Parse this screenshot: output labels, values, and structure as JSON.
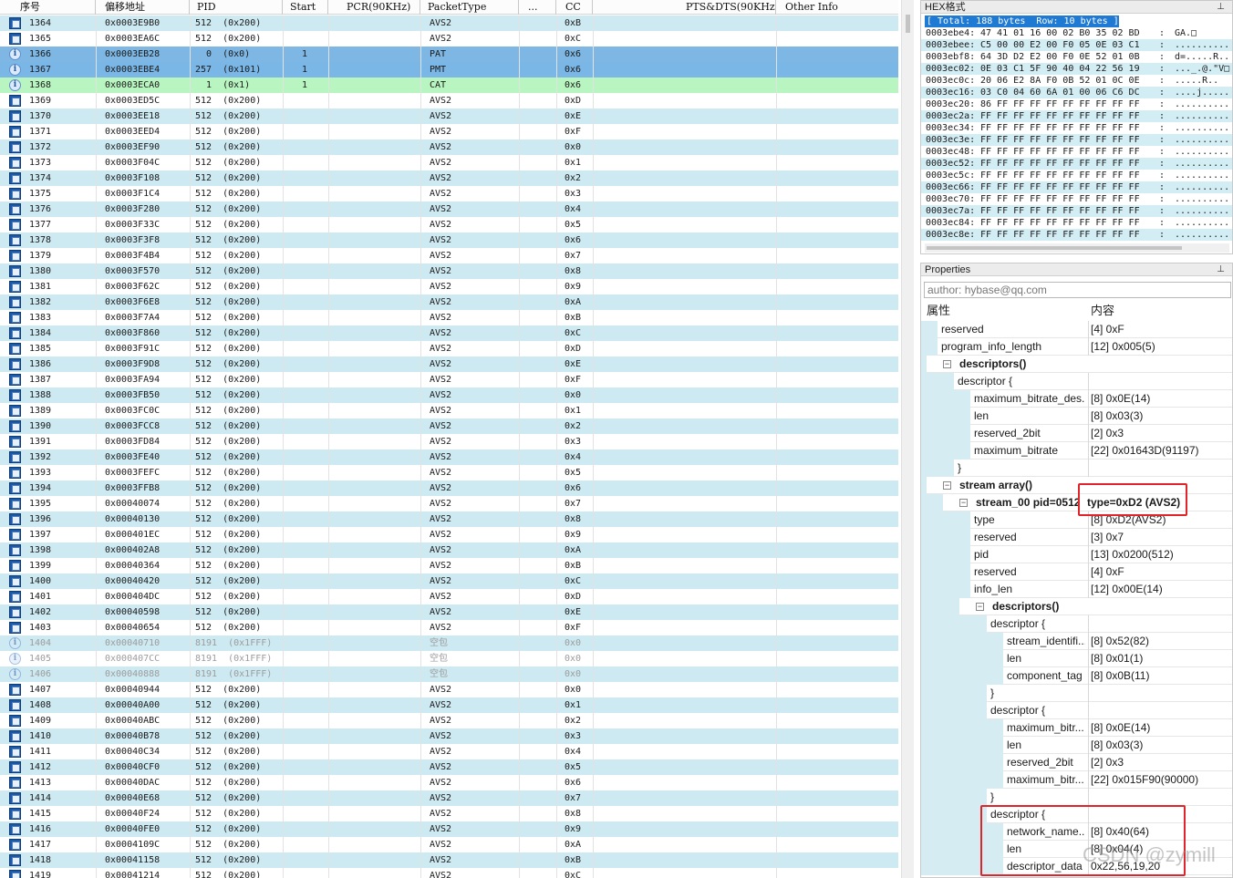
{
  "packet_table": {
    "columns": [
      "序号",
      "偏移地址",
      "PID",
      "Start",
      "PCR(90KHz)",
      "PacketType",
      "...",
      "CC",
      "PTS&DTS(90KHz)",
      "Other Info"
    ],
    "rows": [
      {
        "no": "1364",
        "offset": "0x0003E9B0",
        "pid": "512  (0x200)",
        "start": "",
        "type": "AVS2",
        "cc": "0xB",
        "style": "even",
        "icon": "film-icon"
      },
      {
        "no": "1365",
        "offset": "0x0003EA6C",
        "pid": "512  (0x200)",
        "start": "",
        "type": "AVS2",
        "cc": "0xC",
        "style": "odd",
        "icon": "film-icon"
      },
      {
        "no": "1366",
        "offset": "0x0003EB28",
        "pid": "  0  (0x0)",
        "start": "1",
        "type": "PAT",
        "cc": "0x6",
        "style": "sel",
        "icon": "info-icon"
      },
      {
        "no": "1367",
        "offset": "0x0003EBE4",
        "pid": "257  (0x101)",
        "start": "1",
        "type": "PMT",
        "cc": "0x6",
        "style": "sel2",
        "icon": "info-icon"
      },
      {
        "no": "1368",
        "offset": "0x0003ECA0",
        "pid": "  1  (0x1)",
        "start": "1",
        "type": "CAT",
        "cc": "0x6",
        "style": "cat",
        "icon": "info-icon"
      },
      {
        "no": "1369",
        "offset": "0x0003ED5C",
        "pid": "512  (0x200)",
        "start": "",
        "type": "AVS2",
        "cc": "0xD",
        "style": "odd",
        "icon": "film-icon"
      },
      {
        "no": "1370",
        "offset": "0x0003EE18",
        "pid": "512  (0x200)",
        "start": "",
        "type": "AVS2",
        "cc": "0xE",
        "style": "even",
        "icon": "film-icon"
      },
      {
        "no": "1371",
        "offset": "0x0003EED4",
        "pid": "512  (0x200)",
        "start": "",
        "type": "AVS2",
        "cc": "0xF",
        "style": "odd",
        "icon": "film-icon"
      },
      {
        "no": "1372",
        "offset": "0x0003EF90",
        "pid": "512  (0x200)",
        "start": "",
        "type": "AVS2",
        "cc": "0x0",
        "style": "even",
        "icon": "film-icon"
      },
      {
        "no": "1373",
        "offset": "0x0003F04C",
        "pid": "512  (0x200)",
        "start": "",
        "type": "AVS2",
        "cc": "0x1",
        "style": "odd",
        "icon": "film-icon"
      },
      {
        "no": "1374",
        "offset": "0x0003F108",
        "pid": "512  (0x200)",
        "start": "",
        "type": "AVS2",
        "cc": "0x2",
        "style": "even",
        "icon": "film-icon"
      },
      {
        "no": "1375",
        "offset": "0x0003F1C4",
        "pid": "512  (0x200)",
        "start": "",
        "type": "AVS2",
        "cc": "0x3",
        "style": "odd",
        "icon": "film-icon"
      },
      {
        "no": "1376",
        "offset": "0x0003F280",
        "pid": "512  (0x200)",
        "start": "",
        "type": "AVS2",
        "cc": "0x4",
        "style": "even",
        "icon": "film-icon"
      },
      {
        "no": "1377",
        "offset": "0x0003F33C",
        "pid": "512  (0x200)",
        "start": "",
        "type": "AVS2",
        "cc": "0x5",
        "style": "odd",
        "icon": "film-icon"
      },
      {
        "no": "1378",
        "offset": "0x0003F3F8",
        "pid": "512  (0x200)",
        "start": "",
        "type": "AVS2",
        "cc": "0x6",
        "style": "even",
        "icon": "film-icon"
      },
      {
        "no": "1379",
        "offset": "0x0003F4B4",
        "pid": "512  (0x200)",
        "start": "",
        "type": "AVS2",
        "cc": "0x7",
        "style": "odd",
        "icon": "film-icon"
      },
      {
        "no": "1380",
        "offset": "0x0003F570",
        "pid": "512  (0x200)",
        "start": "",
        "type": "AVS2",
        "cc": "0x8",
        "style": "even",
        "icon": "film-icon"
      },
      {
        "no": "1381",
        "offset": "0x0003F62C",
        "pid": "512  (0x200)",
        "start": "",
        "type": "AVS2",
        "cc": "0x9",
        "style": "odd",
        "icon": "film-icon"
      },
      {
        "no": "1382",
        "offset": "0x0003F6E8",
        "pid": "512  (0x200)",
        "start": "",
        "type": "AVS2",
        "cc": "0xA",
        "style": "even",
        "icon": "film-icon"
      },
      {
        "no": "1383",
        "offset": "0x0003F7A4",
        "pid": "512  (0x200)",
        "start": "",
        "type": "AVS2",
        "cc": "0xB",
        "style": "odd",
        "icon": "film-icon"
      },
      {
        "no": "1384",
        "offset": "0x0003F860",
        "pid": "512  (0x200)",
        "start": "",
        "type": "AVS2",
        "cc": "0xC",
        "style": "even",
        "icon": "film-icon"
      },
      {
        "no": "1385",
        "offset": "0x0003F91C",
        "pid": "512  (0x200)",
        "start": "",
        "type": "AVS2",
        "cc": "0xD",
        "style": "odd",
        "icon": "film-icon"
      },
      {
        "no": "1386",
        "offset": "0x0003F9D8",
        "pid": "512  (0x200)",
        "start": "",
        "type": "AVS2",
        "cc": "0xE",
        "style": "even",
        "icon": "film-icon"
      },
      {
        "no": "1387",
        "offset": "0x0003FA94",
        "pid": "512  (0x200)",
        "start": "",
        "type": "AVS2",
        "cc": "0xF",
        "style": "odd",
        "icon": "film-icon"
      },
      {
        "no": "1388",
        "offset": "0x0003FB50",
        "pid": "512  (0x200)",
        "start": "",
        "type": "AVS2",
        "cc": "0x0",
        "style": "even",
        "icon": "film-icon"
      },
      {
        "no": "1389",
        "offset": "0x0003FC0C",
        "pid": "512  (0x200)",
        "start": "",
        "type": "AVS2",
        "cc": "0x1",
        "style": "odd",
        "icon": "film-icon"
      },
      {
        "no": "1390",
        "offset": "0x0003FCC8",
        "pid": "512  (0x200)",
        "start": "",
        "type": "AVS2",
        "cc": "0x2",
        "style": "even",
        "icon": "film-icon"
      },
      {
        "no": "1391",
        "offset": "0x0003FD84",
        "pid": "512  (0x200)",
        "start": "",
        "type": "AVS2",
        "cc": "0x3",
        "style": "odd",
        "icon": "film-icon"
      },
      {
        "no": "1392",
        "offset": "0x0003FE40",
        "pid": "512  (0x200)",
        "start": "",
        "type": "AVS2",
        "cc": "0x4",
        "style": "even",
        "icon": "film-icon"
      },
      {
        "no": "1393",
        "offset": "0x0003FEFC",
        "pid": "512  (0x200)",
        "start": "",
        "type": "AVS2",
        "cc": "0x5",
        "style": "odd",
        "icon": "film-icon"
      },
      {
        "no": "1394",
        "offset": "0x0003FFB8",
        "pid": "512  (0x200)",
        "start": "",
        "type": "AVS2",
        "cc": "0x6",
        "style": "even",
        "icon": "film-icon"
      },
      {
        "no": "1395",
        "offset": "0x00040074",
        "pid": "512  (0x200)",
        "start": "",
        "type": "AVS2",
        "cc": "0x7",
        "style": "odd",
        "icon": "film-icon"
      },
      {
        "no": "1396",
        "offset": "0x00040130",
        "pid": "512  (0x200)",
        "start": "",
        "type": "AVS2",
        "cc": "0x8",
        "style": "even",
        "icon": "film-icon"
      },
      {
        "no": "1397",
        "offset": "0x000401EC",
        "pid": "512  (0x200)",
        "start": "",
        "type": "AVS2",
        "cc": "0x9",
        "style": "odd",
        "icon": "film-icon"
      },
      {
        "no": "1398",
        "offset": "0x000402A8",
        "pid": "512  (0x200)",
        "start": "",
        "type": "AVS2",
        "cc": "0xA",
        "style": "even",
        "icon": "film-icon"
      },
      {
        "no": "1399",
        "offset": "0x00040364",
        "pid": "512  (0x200)",
        "start": "",
        "type": "AVS2",
        "cc": "0xB",
        "style": "odd",
        "icon": "film-icon"
      },
      {
        "no": "1400",
        "offset": "0x00040420",
        "pid": "512  (0x200)",
        "start": "",
        "type": "AVS2",
        "cc": "0xC",
        "style": "even",
        "icon": "film-icon"
      },
      {
        "no": "1401",
        "offset": "0x000404DC",
        "pid": "512  (0x200)",
        "start": "",
        "type": "AVS2",
        "cc": "0xD",
        "style": "odd",
        "icon": "film-icon"
      },
      {
        "no": "1402",
        "offset": "0x00040598",
        "pid": "512  (0x200)",
        "start": "",
        "type": "AVS2",
        "cc": "0xE",
        "style": "even",
        "icon": "film-icon"
      },
      {
        "no": "1403",
        "offset": "0x00040654",
        "pid": "512  (0x200)",
        "start": "",
        "type": "AVS2",
        "cc": "0xF",
        "style": "odd",
        "icon": "film-icon"
      },
      {
        "no": "1404",
        "offset": "0x00040710",
        "pid": "8191  (0x1FFF)",
        "start": "",
        "type": "空包",
        "cc": "0x0",
        "style": "even null",
        "icon": "info-icon"
      },
      {
        "no": "1405",
        "offset": "0x000407CC",
        "pid": "8191  (0x1FFF)",
        "start": "",
        "type": "空包",
        "cc": "0x0",
        "style": "odd null",
        "icon": "info-icon"
      },
      {
        "no": "1406",
        "offset": "0x00040888",
        "pid": "8191  (0x1FFF)",
        "start": "",
        "type": "空包",
        "cc": "0x0",
        "style": "even null",
        "icon": "info-icon"
      },
      {
        "no": "1407",
        "offset": "0x00040944",
        "pid": "512  (0x200)",
        "start": "",
        "type": "AVS2",
        "cc": "0x0",
        "style": "odd",
        "icon": "film-icon"
      },
      {
        "no": "1408",
        "offset": "0x00040A00",
        "pid": "512  (0x200)",
        "start": "",
        "type": "AVS2",
        "cc": "0x1",
        "style": "even",
        "icon": "film-icon"
      },
      {
        "no": "1409",
        "offset": "0x00040ABC",
        "pid": "512  (0x200)",
        "start": "",
        "type": "AVS2",
        "cc": "0x2",
        "style": "odd",
        "icon": "film-icon"
      },
      {
        "no": "1410",
        "offset": "0x00040B78",
        "pid": "512  (0x200)",
        "start": "",
        "type": "AVS2",
        "cc": "0x3",
        "style": "even",
        "icon": "film-icon"
      },
      {
        "no": "1411",
        "offset": "0x00040C34",
        "pid": "512  (0x200)",
        "start": "",
        "type": "AVS2",
        "cc": "0x4",
        "style": "odd",
        "icon": "film-icon"
      },
      {
        "no": "1412",
        "offset": "0x00040CF0",
        "pid": "512  (0x200)",
        "start": "",
        "type": "AVS2",
        "cc": "0x5",
        "style": "even",
        "icon": "film-icon"
      },
      {
        "no": "1413",
        "offset": "0x00040DAC",
        "pid": "512  (0x200)",
        "start": "",
        "type": "AVS2",
        "cc": "0x6",
        "style": "odd",
        "icon": "film-icon"
      },
      {
        "no": "1414",
        "offset": "0x00040E68",
        "pid": "512  (0x200)",
        "start": "",
        "type": "AVS2",
        "cc": "0x7",
        "style": "even",
        "icon": "film-icon"
      },
      {
        "no": "1415",
        "offset": "0x00040F24",
        "pid": "512  (0x200)",
        "start": "",
        "type": "AVS2",
        "cc": "0x8",
        "style": "odd",
        "icon": "film-icon"
      },
      {
        "no": "1416",
        "offset": "0x00040FE0",
        "pid": "512  (0x200)",
        "start": "",
        "type": "AVS2",
        "cc": "0x9",
        "style": "even",
        "icon": "film-icon"
      },
      {
        "no": "1417",
        "offset": "0x0004109C",
        "pid": "512  (0x200)",
        "start": "",
        "type": "AVS2",
        "cc": "0xA",
        "style": "odd",
        "icon": "film-icon"
      },
      {
        "no": "1418",
        "offset": "0x00041158",
        "pid": "512  (0x200)",
        "start": "",
        "type": "AVS2",
        "cc": "0xB",
        "style": "even",
        "icon": "film-icon"
      },
      {
        "no": "1419",
        "offset": "0x00041214",
        "pid": "512  (0x200)",
        "start": "",
        "type": "AVS2",
        "cc": "0xC",
        "style": "odd",
        "icon": "film-icon"
      }
    ]
  },
  "hex_panel": {
    "title": "HEX格式",
    "pin_icon": "pin-icon",
    "summary": "[ Total: 188 bytes  Row: 10 bytes ]",
    "rows": [
      {
        "addr": "0003ebe4:",
        "bytes": "47 41 01 16 00 02 B0 35 02 BD",
        "text": "GA.□"
      },
      {
        "addr": "0003ebee:",
        "bytes": "C5 00 00 E2 00 F0 05 0E 03 C1",
        "text": ".........."
      },
      {
        "addr": "0003ebf8:",
        "bytes": "64 3D D2 E2 00 F0 0E 52 01 0B",
        "text": "d=.....R.."
      },
      {
        "addr": "0003ec02:",
        "bytes": "0E 03 C1 5F 90 40 04 22 56 19",
        "text": "..._.@.\"V□"
      },
      {
        "addr": "0003ec0c:",
        "bytes": "20 06 E2 8A F0 0B 52 01 0C 0E",
        "text": ".....R.."
      },
      {
        "addr": "0003ec16:",
        "bytes": "03 C0 04 60 6A 01 00 06 C6 DC",
        "text": "....j....."
      },
      {
        "addr": "0003ec20:",
        "bytes": "86 FF FF FF FF FF FF FF FF FF",
        "text": ".........."
      },
      {
        "addr": "0003ec2a:",
        "bytes": "FF FF FF FF FF FF FF FF FF FF",
        "text": ".........."
      },
      {
        "addr": "0003ec34:",
        "bytes": "FF FF FF FF FF FF FF FF FF FF",
        "text": ".........."
      },
      {
        "addr": "0003ec3e:",
        "bytes": "FF FF FF FF FF FF FF FF FF FF",
        "text": ".........."
      },
      {
        "addr": "0003ec48:",
        "bytes": "FF FF FF FF FF FF FF FF FF FF",
        "text": ".........."
      },
      {
        "addr": "0003ec52:",
        "bytes": "FF FF FF FF FF FF FF FF FF FF",
        "text": ".........."
      },
      {
        "addr": "0003ec5c:",
        "bytes": "FF FF FF FF FF FF FF FF FF FF",
        "text": ".........."
      },
      {
        "addr": "0003ec66:",
        "bytes": "FF FF FF FF FF FF FF FF FF FF",
        "text": ".........."
      },
      {
        "addr": "0003ec70:",
        "bytes": "FF FF FF FF FF FF FF FF FF FF",
        "text": ".........."
      },
      {
        "addr": "0003ec7a:",
        "bytes": "FF FF FF FF FF FF FF FF FF FF",
        "text": ".........."
      },
      {
        "addr": "0003ec84:",
        "bytes": "FF FF FF FF FF FF FF FF FF FF",
        "text": ".........."
      },
      {
        "addr": "0003ec8e:",
        "bytes": "FF FF FF FF FF FF FF FF FF FF",
        "text": ".........."
      }
    ]
  },
  "properties_panel": {
    "title": "Properties",
    "author": "author: hybase@qq.com",
    "col_name": "属性",
    "col_value": "内容",
    "rows": [
      {
        "name": "reserved",
        "value": "[4]  0xF",
        "level": 1,
        "cat": false
      },
      {
        "name": "program_info_length",
        "value": "[12] 0x005(5)",
        "level": 1,
        "cat": false
      },
      {
        "name": "descriptors()",
        "value": "",
        "level": 1,
        "cat": true,
        "toggle": "⊟"
      },
      {
        "name": "descriptor {",
        "value": "",
        "level": 2,
        "cat": false
      },
      {
        "name": "maximum_bitrate_des...",
        "value": "[8]  0x0E(14)",
        "level": 3,
        "cat": false
      },
      {
        "name": "len",
        "value": "[8]  0x03(3)",
        "level": 3,
        "cat": false
      },
      {
        "name": "reserved_2bit",
        "value": "[2]  0x3",
        "level": 3,
        "cat": false
      },
      {
        "name": "maximum_bitrate",
        "value": "[22]  0x01643D(91197)",
        "level": 3,
        "cat": false
      },
      {
        "name": "}",
        "value": "",
        "level": 2,
        "cat": false
      },
      {
        "name": "stream array()",
        "value": "",
        "level": 1,
        "cat": true,
        "toggle": "⊟"
      },
      {
        "name": "stream_00 pid=0512",
        "value": "type=0xD2 (AVS2)",
        "level": 2,
        "cat": true,
        "toggle": "⊟"
      },
      {
        "name": "type",
        "value": "[8]  0xD2(AVS2)",
        "level": 3,
        "cat": false
      },
      {
        "name": "reserved",
        "value": "[3]  0x7",
        "level": 3,
        "cat": false
      },
      {
        "name": "pid",
        "value": "[13] 0x0200(512)",
        "level": 3,
        "cat": false
      },
      {
        "name": "reserved",
        "value": "[4]  0xF",
        "level": 3,
        "cat": false
      },
      {
        "name": "info_len",
        "value": "[12] 0x00E(14)",
        "level": 3,
        "cat": false
      },
      {
        "name": "descriptors()",
        "value": "",
        "level": 3,
        "cat": true,
        "toggle": "⊟"
      },
      {
        "name": "descriptor {",
        "value": "",
        "level": 4,
        "cat": false
      },
      {
        "name": "stream_identifi...",
        "value": "[8]  0x52(82)",
        "level": 5,
        "cat": false
      },
      {
        "name": "len",
        "value": "[8]  0x01(1)",
        "level": 5,
        "cat": false
      },
      {
        "name": "component_tag",
        "value": "[8]  0x0B(11)",
        "level": 5,
        "cat": false
      },
      {
        "name": "}",
        "value": "",
        "level": 4,
        "cat": false
      },
      {
        "name": "descriptor {",
        "value": "",
        "level": 4,
        "cat": false
      },
      {
        "name": "maximum_bitr...",
        "value": "[8]  0x0E(14)",
        "level": 5,
        "cat": false
      },
      {
        "name": "len",
        "value": "[8]  0x03(3)",
        "level": 5,
        "cat": false
      },
      {
        "name": "reserved_2bit",
        "value": "[2]  0x3",
        "level": 5,
        "cat": false
      },
      {
        "name": "maximum_bitr...",
        "value": "[22]  0x015F90(90000)",
        "level": 5,
        "cat": false
      },
      {
        "name": "}",
        "value": "",
        "level": 4,
        "cat": false
      },
      {
        "name": "descriptor {",
        "value": "",
        "level": 4,
        "cat": false
      },
      {
        "name": "network_name...",
        "value": "[8]  0x40(64)",
        "level": 5,
        "cat": false
      },
      {
        "name": "len",
        "value": "[8]  0x04(4)",
        "level": 5,
        "cat": false
      },
      {
        "name": "descriptor_data",
        "value": "0x22,56,19,20",
        "level": 5,
        "cat": false
      }
    ]
  },
  "watermark": "CSDN @zymill",
  "colors": {
    "accent_red": "#e0252a",
    "selection_blue": "#7eb7e3",
    "cat_green": "#b9f5c0",
    "row_alt": "#cde9f1"
  }
}
